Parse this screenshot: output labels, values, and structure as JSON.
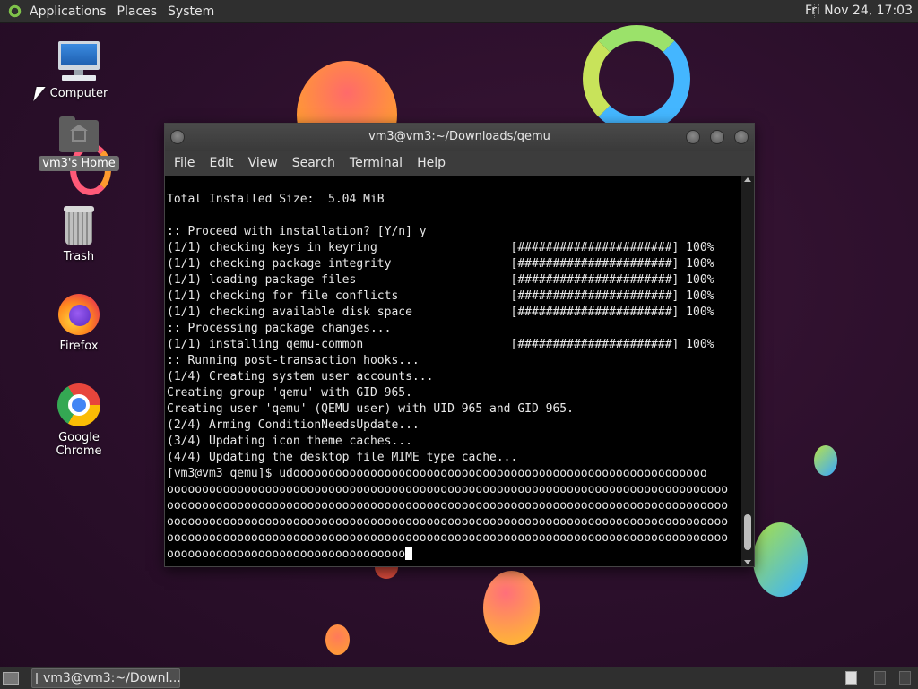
{
  "top_panel": {
    "menus": [
      "Applications",
      "Places",
      "System"
    ],
    "clock": "Fri Nov 24, 17:03"
  },
  "desktop": {
    "icons": [
      {
        "label": "Computer",
        "icon": "computer-icon"
      },
      {
        "label": "vm3's Home",
        "icon": "home-folder-icon"
      },
      {
        "label": "Trash",
        "icon": "trash-icon"
      },
      {
        "label": "Firefox",
        "icon": "firefox-icon"
      },
      {
        "label": "Google Chrome",
        "icon": "chrome-icon"
      }
    ]
  },
  "terminal": {
    "title": "vm3@vm3:~/Downloads/qemu",
    "menus": [
      "File",
      "Edit",
      "View",
      "Search",
      "Terminal",
      "Help"
    ],
    "lines": [
      "",
      "Total Installed Size:  5.04 MiB",
      "",
      ":: Proceed with installation? [Y/n] y",
      "(1/1) checking keys in keyring                   [######################] 100%",
      "(1/1) checking package integrity                 [######################] 100%",
      "(1/1) loading package files                      [######################] 100%",
      "(1/1) checking for file conflicts                [######################] 100%",
      "(1/1) checking available disk space              [######################] 100%",
      ":: Processing package changes...",
      "(1/1) installing qemu-common                     [######################] 100%",
      ":: Running post-transaction hooks...",
      "(1/4) Creating system user accounts...",
      "Creating group 'qemu' with GID 965.",
      "Creating user 'qemu' (QEMU user) with UID 965 and GID 965.",
      "(2/4) Arming ConditionNeedsUpdate...",
      "(3/4) Updating icon theme caches...",
      "(4/4) Updating the desktop file MIME type cache...",
      "[vm3@vm3 qemu]$ udooooooooooooooooooooooooooooooooooooooooooooooooooooooooooo",
      "oooooooooooooooooooooooooooooooooooooooooooooooooooooooooooooooooooooooooooooooo",
      "oooooooooooooooooooooooooooooooooooooooooooooooooooooooooooooooooooooooooooooooo",
      "oooooooooooooooooooooooooooooooooooooooooooooooooooooooooooooooooooooooooooooooo",
      "oooooooooooooooooooooooooooooooooooooooooooooooooooooooooooooooooooooooooooooooo",
      "oooooooooooooooooooooooooooooooooo"
    ]
  },
  "bottom_panel": {
    "task_label": "vm3@vm3:~/Downl..."
  },
  "colors": {
    "panel": "#2f2f2f",
    "desktop": "#2a0f2a",
    "terminal_bg": "#000000",
    "terminal_fg": "#e8e8e8"
  }
}
